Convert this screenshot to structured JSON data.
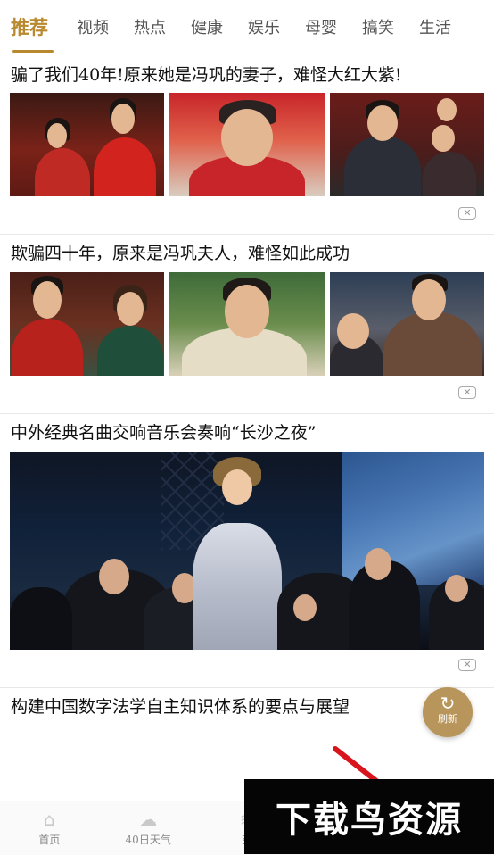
{
  "tabs": [
    {
      "label": "推荐",
      "active": true
    },
    {
      "label": "视频"
    },
    {
      "label": "热点"
    },
    {
      "label": "健康"
    },
    {
      "label": "娱乐"
    },
    {
      "label": "母婴"
    },
    {
      "label": "搞笑"
    },
    {
      "label": "生活"
    }
  ],
  "feed": {
    "article1": {
      "title": "骗了我们40年!原来她是冯巩的妻子，难怪大红大紫!"
    },
    "article2": {
      "title": "欺骗四十年，原来是冯巩夫人，难怪如此成功"
    },
    "article3": {
      "title": "中外经典名曲交响音乐会奏响“长沙之夜”"
    },
    "article4": {
      "title": "构建中国数字法学自主知识体系的要点与展望"
    },
    "dislike_icon": "close-icon"
  },
  "refresh": {
    "label": "刷新",
    "icon": "refresh-icon"
  },
  "bottom_nav": [
    {
      "label": "首页",
      "icon": "home-icon"
    },
    {
      "label": "40日天气",
      "icon": "cloud-icon"
    },
    {
      "label": "空",
      "icon": "air-icon"
    },
    {
      "label": "",
      "icon": "calendar-icon"
    },
    {
      "label": "",
      "icon": "news-icon"
    }
  ],
  "watermark": {
    "text": "下载鸟资源"
  },
  "colors": {
    "accent": "#b8892f",
    "refresh_bg": "#b8955a"
  }
}
